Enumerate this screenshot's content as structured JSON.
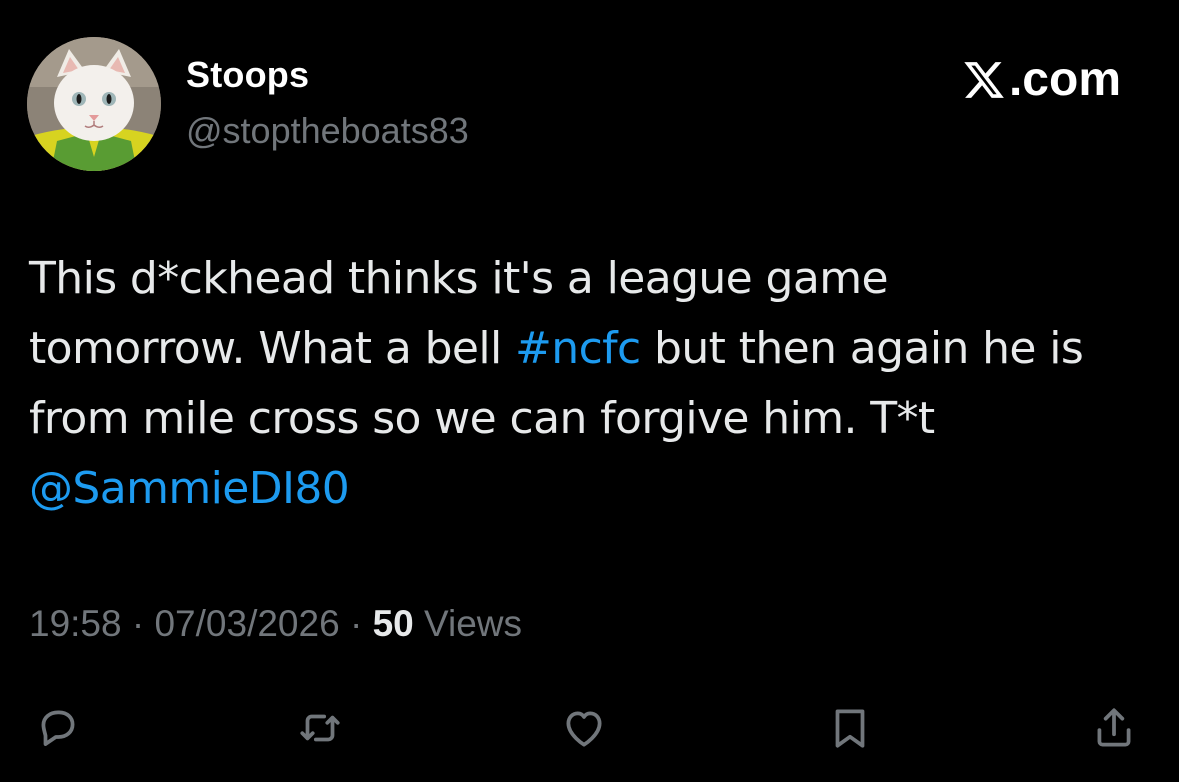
{
  "author": {
    "display_name": "Stoops",
    "handle": "@stoptheboats83",
    "avatar_icon": "cat-avatar"
  },
  "brand": {
    "label": ".com",
    "icon": "x-logo-icon"
  },
  "tweet": {
    "lines": [
      {
        "text": "This d*ckhead thinks it's a league game"
      },
      {
        "before": "tomorrow. What a bell ",
        "hashtag": "#ncfc",
        "after": " but then again he is"
      },
      {
        "text": "from mile cross so we can forgive him. T*t"
      },
      {
        "mention": "@SammieDI80"
      }
    ]
  },
  "meta": {
    "time": "19:58",
    "separator": " · ",
    "date": "07/03/2026",
    "views_count": "50",
    "views_label": " Views"
  },
  "actions": [
    {
      "name": "reply-icon"
    },
    {
      "name": "repost-icon"
    },
    {
      "name": "like-icon"
    },
    {
      "name": "bookmark-icon"
    },
    {
      "name": "share-icon"
    }
  ],
  "colors": {
    "background": "#000000",
    "text": "#e7e9ea",
    "secondary": "#71767b",
    "link": "#1d9bf0"
  }
}
